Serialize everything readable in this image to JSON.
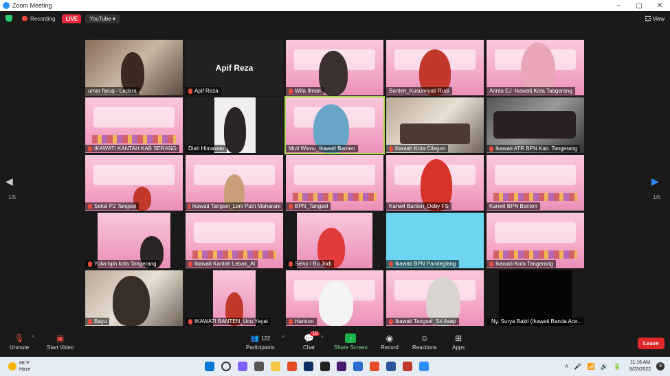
{
  "window": {
    "title": "Zoom Meeting"
  },
  "status": {
    "recording": "Recording",
    "live": "LIVE",
    "stream": "YouTube",
    "view": "View"
  },
  "gallery": {
    "page": "1/5",
    "page_right": "1/5",
    "tiles": [
      {
        "name": "umar faruq - Ladara",
        "muted": false
      },
      {
        "name": "Apif Reza",
        "muted": true,
        "big": "Apif Reza"
      },
      {
        "name": "Wita Ilman",
        "muted": true
      },
      {
        "name": "Banten_Kusumiyati Rudi",
        "muted": false
      },
      {
        "name": "Arinta EJ -Ikawati Kota Tabgerang",
        "muted": false
      },
      {
        "name": "IKAWATI KANTAH KAB SERANG",
        "muted": true
      },
      {
        "name": "Diah Himawan",
        "muted": false
      },
      {
        "name": "Muti Wisnu_Ikawati Banten",
        "muted": false
      },
      {
        "name": "Kantah Kota Cilegon",
        "muted": true
      },
      {
        "name": "Ikawati ATR BPN Kab. Tangerang",
        "muted": true
      },
      {
        "name": "Seksi P2 Tangsel",
        "muted": true
      },
      {
        "name": "Ikawati Tangsel_Leni Putri Maharani",
        "muted": true
      },
      {
        "name": "BPN_Tangsel",
        "muted": true
      },
      {
        "name": "Kanwil Banten_Deby FS",
        "muted": false
      },
      {
        "name": "Kanwil BPN Banten",
        "muted": false
      },
      {
        "name": "Yulia-bpn kota Tangerang",
        "muted": true
      },
      {
        "name": "Ikawati Kantah Lebak_Al",
        "muted": true
      },
      {
        "name": "Selvy / Bu Jodi",
        "muted": true
      },
      {
        "name": "Ikawati BPN Pandeglang",
        "muted": true
      },
      {
        "name": "Ikawati-Kota Tangerang",
        "muted": true
      },
      {
        "name": "Bayu",
        "muted": true
      },
      {
        "name": "IKAWATI BANTEN_Ucu Yayat",
        "muted": true
      },
      {
        "name": "Harison",
        "muted": true
      },
      {
        "name": "Ikawati Tangsel_Sri Asep",
        "muted": true
      },
      {
        "name": "Ny. Surya Bakti (Ikawati Banda Ace...",
        "muted": true
      }
    ]
  },
  "toolbar": {
    "unmute": "Unmute",
    "start_video": "Start Video",
    "participants": "Participants",
    "participants_count": "122",
    "chat": "Chat",
    "chat_badge": "18",
    "share_screen": "Share Screen",
    "record": "Record",
    "reactions": "Reactions",
    "apps": "Apps",
    "leave": "Leave"
  },
  "taskbar": {
    "temp": "88°F",
    "weather": "Haze",
    "time": "11:16 AM",
    "date": "8/23/2022",
    "notif": "3"
  },
  "colors": {
    "accent": "#2d8cff",
    "live": "#e8293a",
    "leave": "#e02828",
    "active_speaker": "#a8d84b",
    "share": "#1cb34a"
  }
}
